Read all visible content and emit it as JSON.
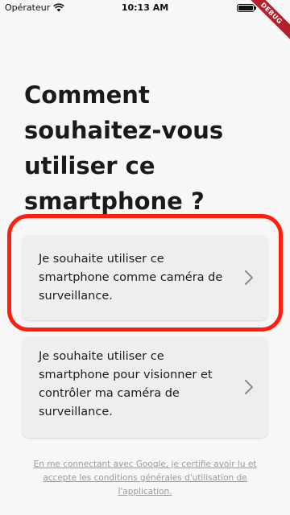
{
  "status_bar": {
    "carrier": "Opérateur",
    "time": "10:13 AM",
    "battery_level": 1.0
  },
  "debug_banner": "DEBUG",
  "title": "Comment souhaitez-vous utiliser ce smartphone ?",
  "options": [
    {
      "label": "Je souhaite utiliser ce smartphone comme caméra de surveillance.",
      "icon": "chevron-right-icon"
    },
    {
      "label": "Je souhaite utiliser ce smartphone pour visionner et contrôler ma caméra de surveillance.",
      "icon": "chevron-right-icon"
    }
  ],
  "consent": "En me connectant avec Google, je certifie avoir lu et accepte les conditions générales d'utilisation de l'application.",
  "colors": {
    "background": "#f7f7f7",
    "card": "#eeeeee",
    "highlight": "#ff1f0f",
    "debug": "#b3202a"
  }
}
